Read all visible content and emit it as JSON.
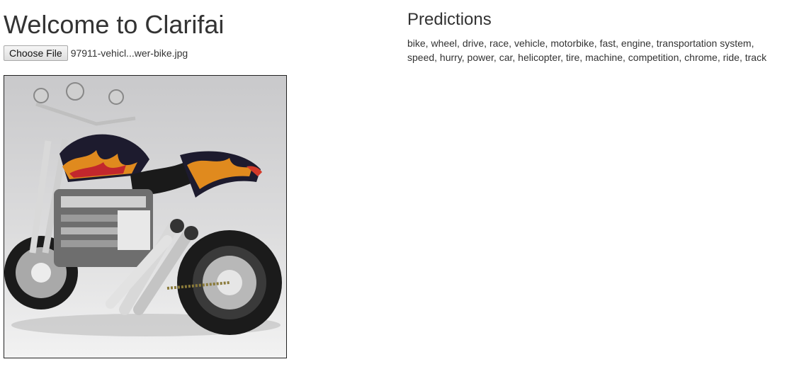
{
  "page": {
    "title": "Welcome to Clarifai"
  },
  "upload": {
    "button_label": "Choose File",
    "file_name": "97911-vehicl...wer-bike.jpg"
  },
  "preview": {
    "alt": "motorbike photo",
    "icon": "motorbike-photo"
  },
  "predictions": {
    "title": "Predictions",
    "tags_text": "bike, wheel, drive, race, vehicle, motorbike, fast, engine, transportation system, speed, hurry, power, car, helicopter, tire, machine, competition, chrome, ride, track"
  }
}
